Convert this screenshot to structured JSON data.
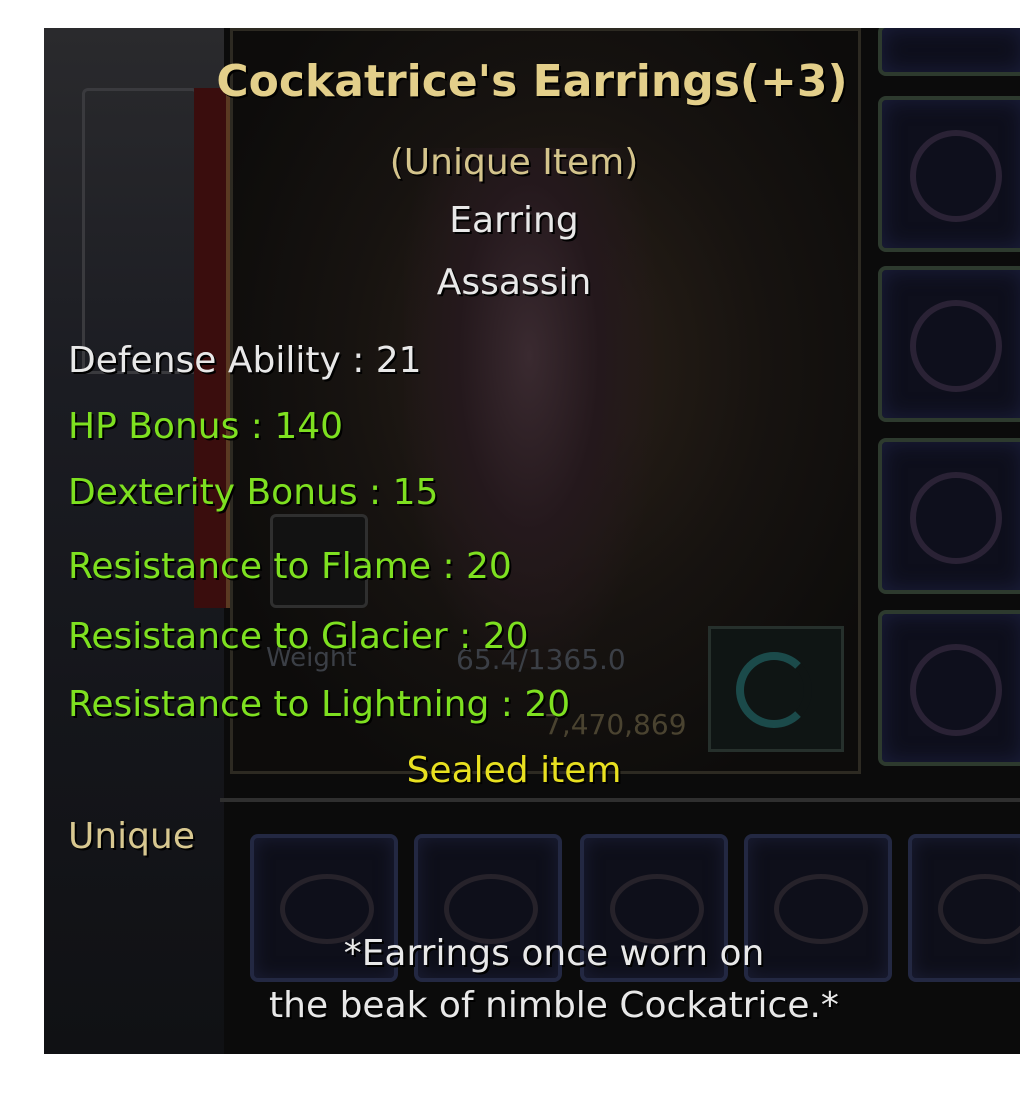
{
  "tooltip": {
    "title": "Cockatrice's Earrings(+3)",
    "grade": "(Unique Item)",
    "type": "Earring",
    "class": "Assassin",
    "stats": [
      {
        "label": "Defense Ability : 21",
        "color": "#e8e8e8"
      },
      {
        "label": "HP Bonus : 140",
        "color": "#7ee020"
      },
      {
        "label": "Dexterity Bonus : 15",
        "color": "#7ee020"
      },
      {
        "label": "Resistance to Flame : 20",
        "color": "#7ee020"
      },
      {
        "label": "Resistance to Glacier : 20",
        "color": "#7ee020"
      },
      {
        "label": "Resistance to Lightning : 20",
        "color": "#7ee020"
      }
    ],
    "sealed": "Sealed item",
    "rarity": "Unique",
    "flavor_line1": "*Earrings once worn on",
    "flavor_line2": "the beak of nimble Cockatrice.*"
  },
  "background": {
    "weight_label": "Weight",
    "weight_value": "65.4/1365.0",
    "gold_value": "7,470,869"
  },
  "colors": {
    "title": "#e3cf8a",
    "grade": "#d4c48c",
    "white": "#e8e8e8",
    "bonus_green": "#7ee020",
    "sealed_yellow": "#e8e020",
    "rarity": "#d8c890"
  }
}
